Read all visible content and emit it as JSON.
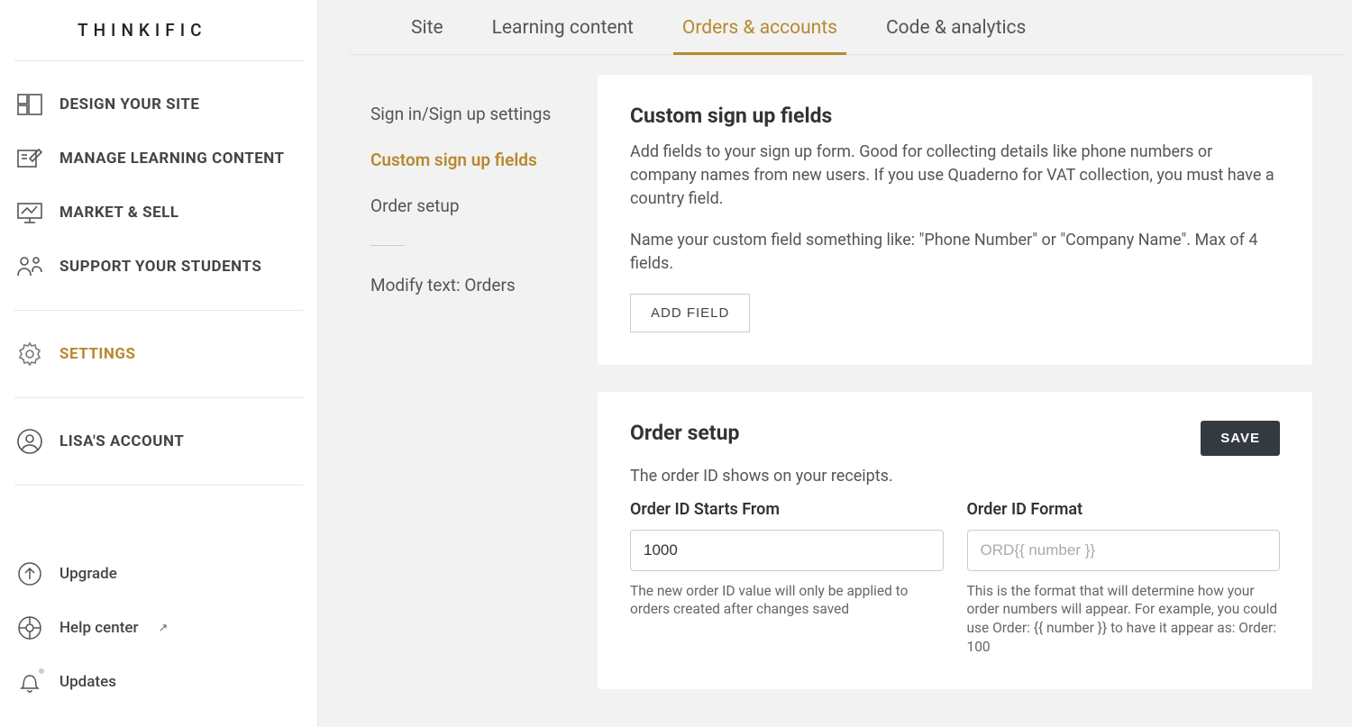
{
  "logo": "THINKIFIC",
  "sidebar": {
    "items": [
      {
        "label": "DESIGN YOUR SITE"
      },
      {
        "label": "MANAGE LEARNING CONTENT"
      },
      {
        "label": "MARKET & SELL"
      },
      {
        "label": "SUPPORT YOUR STUDENTS"
      }
    ],
    "settings_label": "SETTINGS",
    "account_label": "LISA'S ACCOUNT",
    "bottom": {
      "upgrade": "Upgrade",
      "help": "Help center",
      "updates": "Updates"
    }
  },
  "tabs": [
    {
      "label": "Site"
    },
    {
      "label": "Learning content"
    },
    {
      "label": "Orders & accounts"
    },
    {
      "label": "Code & analytics"
    }
  ],
  "subnav": [
    {
      "label": "Sign in/Sign up settings"
    },
    {
      "label": "Custom sign up fields"
    },
    {
      "label": "Order setup"
    },
    {
      "label": "Modify text: Orders"
    }
  ],
  "custom_fields": {
    "title": "Custom sign up fields",
    "desc1": "Add fields to your sign up form. Good for collecting details like phone numbers or company names from new users. If you use Quaderno for VAT collection, you must have a country field.",
    "desc2": "Name your custom field something like: \"Phone Number\" or \"Company Name\". Max of 4 fields.",
    "button": "ADD FIELD"
  },
  "order_setup": {
    "title": "Order setup",
    "save": "SAVE",
    "subtitle": "The order ID shows on your receipts.",
    "id_label": "Order ID Starts From",
    "id_value": "1000",
    "id_help": "The new order ID value will only be applied to orders created after changes saved",
    "format_label": "Order ID Format",
    "format_placeholder": "ORD{{ number }}",
    "format_help": "This is the format that will determine how your order numbers will appear. For example, you could use Order: {{ number }} to have it appear as: Order: 100"
  }
}
